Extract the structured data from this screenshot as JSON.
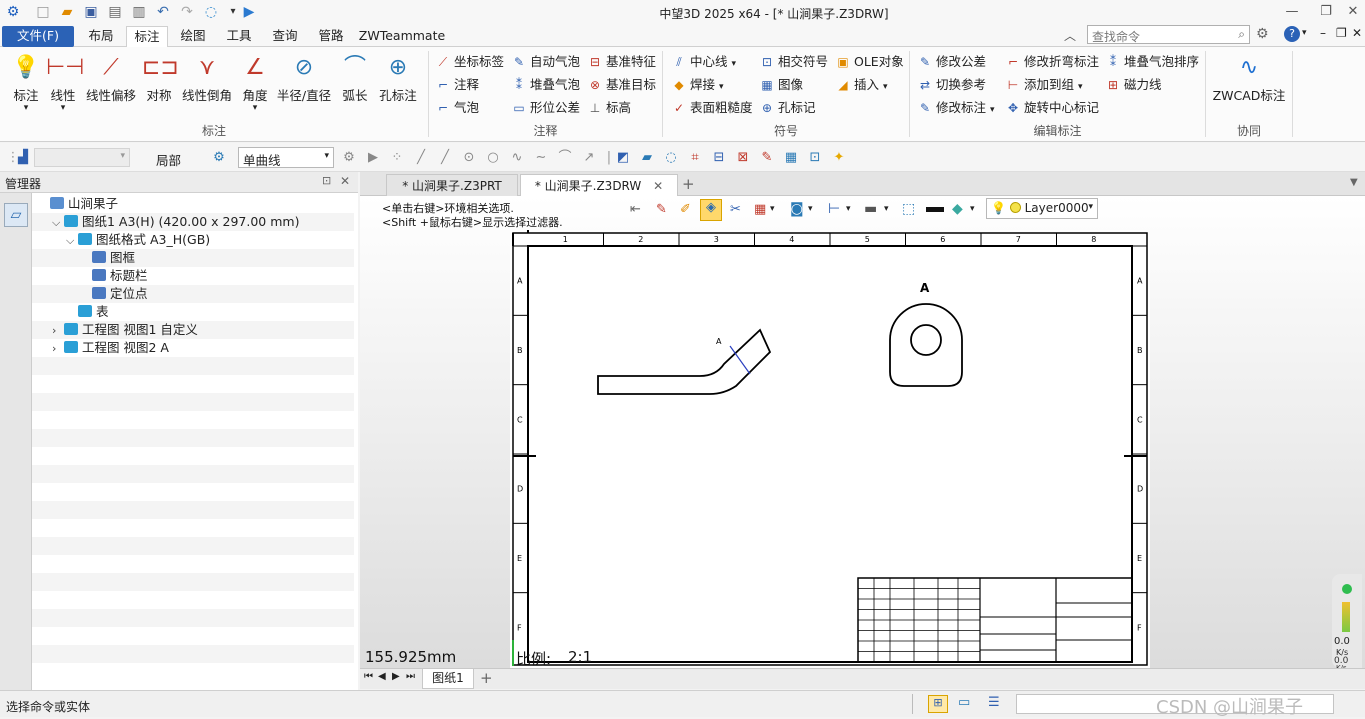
{
  "titlebar": {
    "title": "中望3D 2025 x64 - [* 山涧果子.Z3DRW]"
  },
  "menu": {
    "file": "文件(F)",
    "tabs": [
      "布局",
      "标注",
      "绘图",
      "工具",
      "查询",
      "管路",
      "ZWTeammate"
    ],
    "search_placeholder": "查找命令"
  },
  "ribbon": {
    "dim_buttons": [
      "标注",
      "线性",
      "线性偏移",
      "对称",
      "线性倒角",
      "角度",
      "半径/直径",
      "弧长",
      "孔标注"
    ],
    "dim_group": "标注",
    "annot_col1": [
      "坐标标签",
      "注释",
      "气泡"
    ],
    "annot_col2": [
      "自动气泡",
      "堆叠气泡",
      "形位公差"
    ],
    "annot_col3": [
      "基准特征",
      "基准目标",
      "标高"
    ],
    "annot_group": "注释",
    "sym_col1": [
      "中心线",
      "焊接",
      "表面粗糙度"
    ],
    "sym_col2": [
      "相交符号",
      "图像",
      "孔标记"
    ],
    "sym_col3": [
      "OLE对象",
      "插入"
    ],
    "sym_group": "符号",
    "edit_col1": [
      "修改公差",
      "切换参考",
      "修改标注"
    ],
    "edit_col2": [
      "修改折弯标注",
      "添加到组",
      "旋转中心标记"
    ],
    "edit_col3": [
      "堆叠气泡排序",
      "磁力线"
    ],
    "edit_group": "编辑标注",
    "collab_button": "ZWCAD标注",
    "collab_group": "协同"
  },
  "toolbar2": {
    "scope": "局部",
    "curve_type": "单曲线"
  },
  "manager": {
    "title": "管理器",
    "tree": [
      {
        "label": "山涧果子",
        "indent": 0
      },
      {
        "label": "图纸1 A3(H) (420.00 x 297.00 mm)",
        "indent": 1
      },
      {
        "label": "图纸格式 A3_H(GB)",
        "indent": 2
      },
      {
        "label": "图框",
        "indent": 3
      },
      {
        "label": "标题栏",
        "indent": 3
      },
      {
        "label": "定位点",
        "indent": 3
      },
      {
        "label": "表",
        "indent": 2
      },
      {
        "label": "工程图 视图1 自定义",
        "indent": 1
      },
      {
        "label": "工程图 视图2 A",
        "indent": 1
      }
    ]
  },
  "doctabs": [
    "* 山涧果子.Z3PRT",
    "* 山涧果子.Z3DRW"
  ],
  "canvas": {
    "hint1": "<单击右键>环境相关选项.",
    "hint2": "<Shift +鼠标右键>显示选择过滤器.",
    "layer": "Layer0000",
    "measure": "155.925mm",
    "scale_label": "比例:",
    "scale_value": "2:1",
    "col_labels": [
      "1",
      "2",
      "3",
      "4",
      "5",
      "6",
      "7",
      "8"
    ],
    "row_labels": [
      "A",
      "B",
      "C",
      "D",
      "E",
      "F"
    ],
    "view_label": "A",
    "section_label": "A",
    "perf_value1": "0.0",
    "perf_unit1": "K/s",
    "perf_value2": "0.0",
    "perf_unit2": "K/s"
  },
  "sheettabs": [
    "图纸1"
  ],
  "status": {
    "prompt": "选择命令或实体",
    "watermark": "CSDN @山涧果子"
  }
}
